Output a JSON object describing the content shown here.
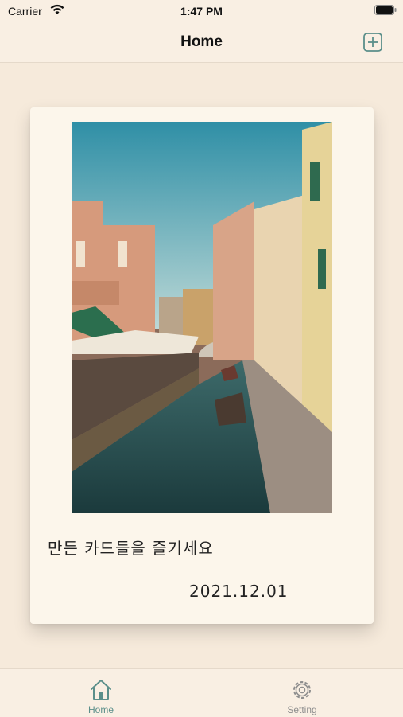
{
  "status_bar": {
    "carrier": "Carrier",
    "time": "1:47 PM"
  },
  "nav": {
    "title": "Home"
  },
  "card": {
    "text": "만든 카드들을 즐기세요",
    "date": "2021.12.01"
  },
  "tab_bar": {
    "home_label": "Home",
    "setting_label": "Setting"
  },
  "colors": {
    "accent": "#5b8f8a",
    "background": "#f6eadb",
    "card": "#fcf6eb",
    "inactive_tab": "#8e8e8e"
  }
}
